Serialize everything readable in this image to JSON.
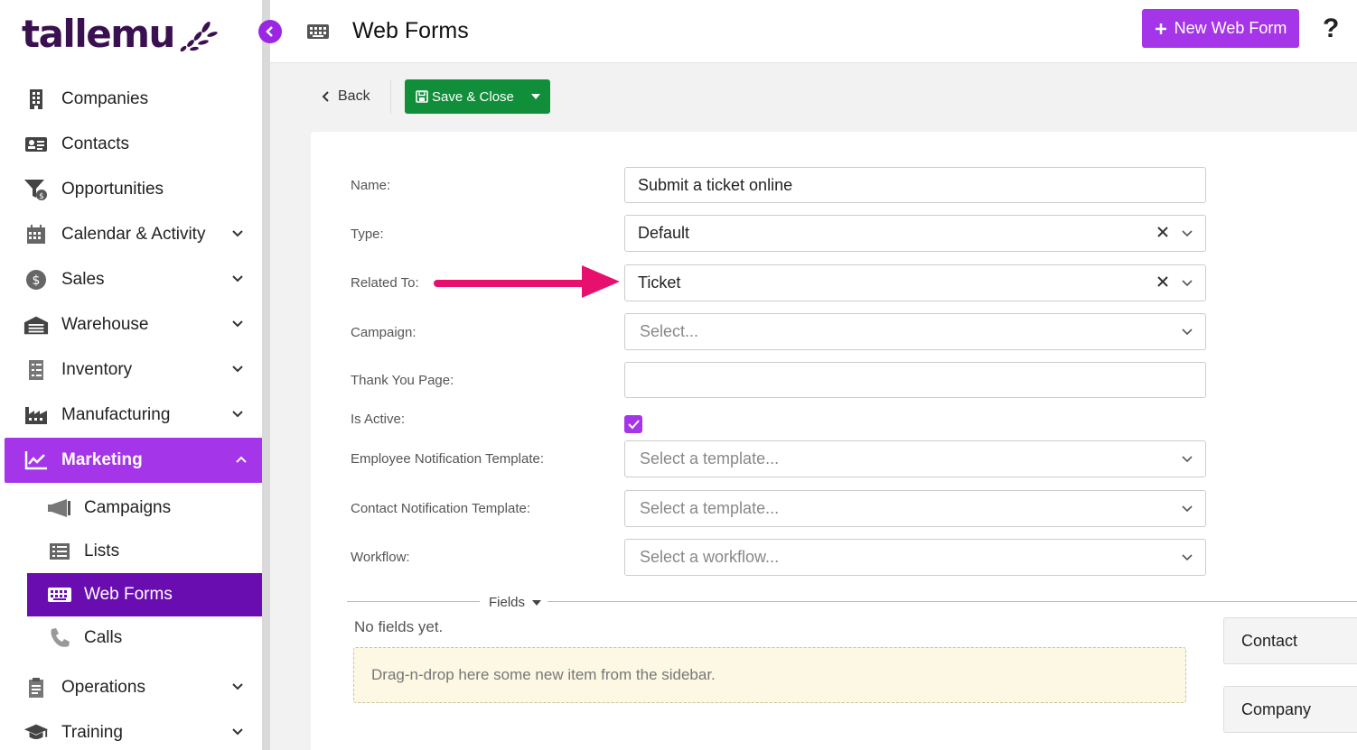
{
  "app": {
    "brand": "tallemu",
    "accent": "#a435e8",
    "accent_dark": "#6a0db0",
    "brand_color": "#3a1050"
  },
  "sidebar": {
    "items": [
      {
        "label": "Companies",
        "icon": "building-icon",
        "has_chevron": false
      },
      {
        "label": "Contacts",
        "icon": "id-card-icon",
        "has_chevron": false
      },
      {
        "label": "Opportunities",
        "icon": "funnel-icon",
        "has_chevron": false
      },
      {
        "label": "Calendar & Activity",
        "icon": "calendar-icon",
        "has_chevron": true
      },
      {
        "label": "Sales",
        "icon": "dollar-icon",
        "has_chevron": true
      },
      {
        "label": "Warehouse",
        "icon": "warehouse-icon",
        "has_chevron": true
      },
      {
        "label": "Inventory",
        "icon": "checklist-icon",
        "has_chevron": true
      },
      {
        "label": "Manufacturing",
        "icon": "factory-icon",
        "has_chevron": true
      },
      {
        "label": "Marketing",
        "icon": "chart-line-icon",
        "has_chevron": true,
        "expanded": true
      }
    ],
    "marketing_sub": [
      {
        "label": "Campaigns",
        "icon": "megaphone-icon"
      },
      {
        "label": "Lists",
        "icon": "list-icon"
      },
      {
        "label": "Web Forms",
        "icon": "keyboard-icon",
        "selected": true
      },
      {
        "label": "Calls",
        "icon": "phone-icon"
      }
    ],
    "items_after": [
      {
        "label": "Operations",
        "icon": "clipboard-icon",
        "has_chevron": true
      },
      {
        "label": "Training",
        "icon": "graduation-cap-icon",
        "has_chevron": true
      }
    ]
  },
  "header": {
    "title": "Web Forms",
    "new_button": "New Web Form",
    "help": "?"
  },
  "toolbar": {
    "back": "Back",
    "save_close": "Save & Close"
  },
  "form": {
    "name_label": "Name:",
    "name_value": "Submit a ticket online",
    "type_label": "Type:",
    "type_value": "Default",
    "related_label": "Related To:",
    "related_value": "Ticket",
    "campaign_label": "Campaign:",
    "campaign_placeholder": "Select...",
    "thankyou_label": "Thank You Page:",
    "thankyou_value": "",
    "active_label": "Is Active:",
    "active_checked": true,
    "employee_tpl_label": "Employee Notification Template:",
    "employee_tpl_placeholder": "Select a template...",
    "contact_tpl_label": "Contact Notification Template:",
    "contact_tpl_placeholder": "Select a template...",
    "workflow_label": "Workflow:",
    "workflow_placeholder": "Select a workflow..."
  },
  "fields_section": {
    "label": "Fields",
    "empty": "No fields yet.",
    "drop_hint": "Drag-n-drop here some new item from the sidebar."
  },
  "side_tiles": [
    "Contact",
    "Company"
  ],
  "annotation": {
    "arrow_color": "#e8106e"
  }
}
